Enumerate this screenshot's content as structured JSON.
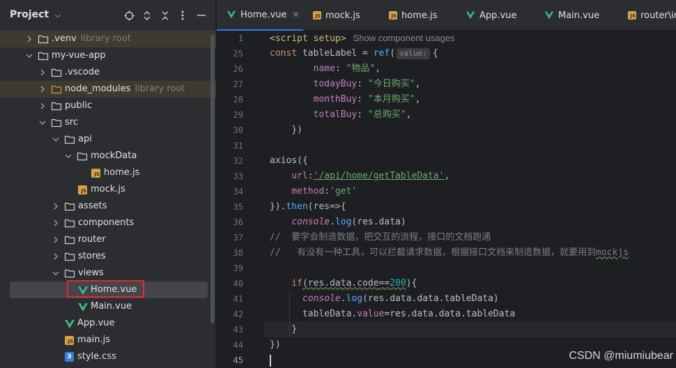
{
  "project": {
    "title": "Project",
    "items": [
      {
        "name": ".venv",
        "hint": "library root"
      },
      {
        "name": "my-vue-app"
      },
      {
        "name": ".vscode"
      },
      {
        "name": "node_modules",
        "hint": "library root"
      },
      {
        "name": "public"
      },
      {
        "name": "src"
      },
      {
        "name": "api"
      },
      {
        "name": "mockData"
      },
      {
        "name": "home.js"
      },
      {
        "name": "mock.js"
      },
      {
        "name": "assets"
      },
      {
        "name": "components"
      },
      {
        "name": "router"
      },
      {
        "name": "stores"
      },
      {
        "name": "views"
      },
      {
        "name": "Home.vue"
      },
      {
        "name": "Main.vue"
      },
      {
        "name": "App.vue"
      },
      {
        "name": "main.js"
      },
      {
        "name": "style.css"
      }
    ]
  },
  "tabs": [
    {
      "label": "Home.vue"
    },
    {
      "label": "mock.js"
    },
    {
      "label": "home.js"
    },
    {
      "label": "App.vue"
    },
    {
      "label": "Main.vue"
    },
    {
      "label": "router\\in"
    }
  ],
  "editor": {
    "line_numbers": [
      "1",
      "25",
      "26",
      "27",
      "28",
      "29",
      "30",
      "31",
      "32",
      "33",
      "34",
      "35",
      "36",
      "37",
      "38",
      "39",
      "40",
      "41",
      "42",
      "43",
      "44",
      "45"
    ],
    "code": {
      "l1_tag": "<script setup>",
      "l1_usage": "Show component usages",
      "l25_a": "const ",
      "l25_b": "tableLabel = ",
      "l25_c": "ref",
      "l25_d": "(",
      "l25_inlay": "value:",
      "l25_e": "{",
      "l26_k": "name",
      "l26_v": "\"物品\"",
      "l27_k": "todayBuy",
      "l27_v": "\"今日购买\"",
      "l28_k": "monthBuy",
      "l28_v": "\"本月购买\"",
      "l29_k": "totalBuy",
      "l29_v": "\"总购买\"",
      "l30": "})",
      "l32": "axios({",
      "l33_k": "url",
      "l33_v": "'/api/home/getTableData'",
      "l34_k": "method",
      "l34_v": "'get'",
      "l35_a": "}).",
      "l35_b": "then",
      "l35_c": "(res=>{",
      "l36_a": "console",
      "l36_b": ".",
      "l36_c": "log",
      "l36_d": "(res.data)",
      "l37": "//  要学会制造数据，把交互的流程，接口的文档跑通",
      "l38_a": "//   有没有一种工具，可以拦截请求数据，根据接口文档来制造数据，就要用到",
      "l38_b": "mockjs",
      "l40_a": "if",
      "l40_b": "(res.data.code",
      "l40_c": "==",
      "l40_d": "200",
      "l40_e": "){",
      "l41_a": "console",
      "l41_b": ".",
      "l41_c": "log",
      "l41_d": "(res.data.data.tableData)",
      "l42_a": "tableData.",
      "l42_b": "value",
      "l42_c": "=res.data.data.tableData",
      "l43": "}",
      "l44": "})"
    }
  },
  "watermark": "CSDN @miumiubear"
}
